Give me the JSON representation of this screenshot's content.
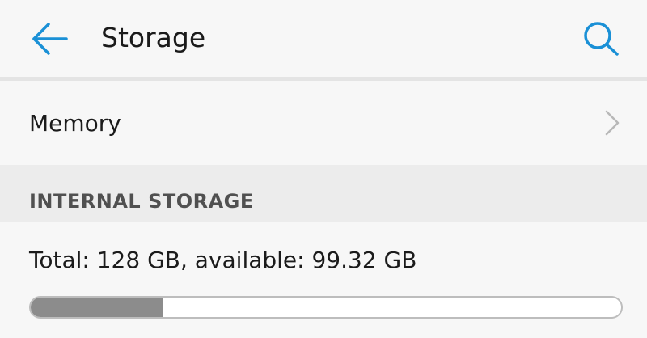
{
  "app_bar": {
    "title": "Storage",
    "back_icon": "arrow-left-icon",
    "search_icon": "search-icon",
    "accent_color": "#1a90d6"
  },
  "memory_row": {
    "label": "Memory",
    "chevron_icon": "chevron-right-icon"
  },
  "internal_storage": {
    "section_label": "INTERNAL STORAGE",
    "summary": "Total: 128 GB, available: 99.32 GB",
    "used_fraction": 0.224,
    "bar_fill_color": "#8c8c8c"
  }
}
